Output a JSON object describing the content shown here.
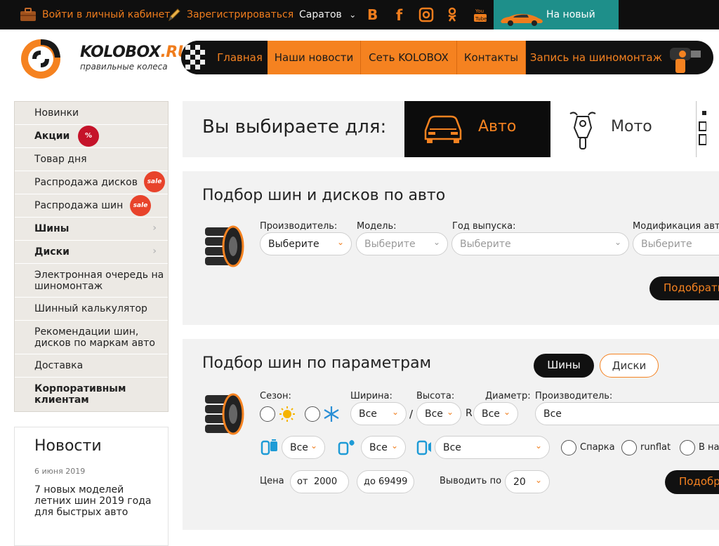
{
  "topbar": {
    "login": "Войти в личный кабинет",
    "register": "Зарегистрироваться",
    "city": "Саратов",
    "new_site": "На новый сайт",
    "social": [
      "vk-icon",
      "facebook-icon",
      "instagram-icon",
      "odnoklassniki-icon",
      "youtube-icon"
    ]
  },
  "header": {
    "logo_main": "KOLOBOX",
    "logo_tld": ".RU",
    "logo_sub": "правильные колеса",
    "nav": [
      "Главная",
      "Наши новости",
      "Сеть KOLOBOX",
      "Контакты",
      "Запись на шиномонтаж"
    ]
  },
  "sidebar": {
    "items": [
      {
        "label": "Новинки"
      },
      {
        "label": "Акции",
        "badge": "%"
      },
      {
        "label": "Товар дня"
      },
      {
        "label": "Распродажа дисков",
        "badge": "sale"
      },
      {
        "label": "Распродажа шин",
        "badge": "sale"
      },
      {
        "label": "Шины"
      },
      {
        "label": "Диски"
      },
      {
        "label": "Электронная очередь на шиномонтаж"
      },
      {
        "label": "Шинный калькулятор"
      },
      {
        "label": "Рекомендации шин, дисков по маркам авто"
      },
      {
        "label": "Доставка"
      },
      {
        "label": "Корпоративным клиентам"
      }
    ]
  },
  "news": {
    "title": "Новости",
    "date": "6 июня 2019",
    "text": "7 новых моделей летних шин 2019 года для быстрых авто"
  },
  "chooser": {
    "title": "Вы выбираете для:",
    "auto": "Авто",
    "moto": "Мото"
  },
  "by_car": {
    "title": "Подбор шин и дисков по авто",
    "labels": {
      "maker": "Производитель:",
      "model": "Модель:",
      "year": "Год выпуска:",
      "mod": "Модификация авто"
    },
    "values": {
      "maker": "Выберите",
      "model": "Выберите",
      "year": "Выберите",
      "mod": "Выберите"
    },
    "submit": "Подобрать"
  },
  "by_params": {
    "title": "Подбор шин по параметрам",
    "tab_tires": "Шины",
    "tab_disks": "Диски",
    "labels": {
      "season": "Сезон:",
      "width": "Ширина:",
      "height": "Высота:",
      "diameter": "Диаметр:",
      "maker": "Производитель:",
      "price": "Цена",
      "per_page": "Выводить по"
    },
    "values": {
      "width": "Все",
      "height": "Все",
      "diameter": "Все",
      "maker": "Все",
      "f1": "Все",
      "f2": "Все",
      "f3": "Все",
      "per_page": "20"
    },
    "slash": "/",
    "r": "R",
    "checks": [
      "Спарка",
      "runflat",
      "В нал"
    ],
    "price_from_prefix": "от",
    "price_from": "2000",
    "price_to_prefix": "до",
    "price_to": "69499",
    "submit": "Подобр"
  },
  "colors": {
    "accent": "#f58220",
    "dark": "#111111",
    "teal": "#1e8f8a",
    "sale": "#e8432b"
  }
}
